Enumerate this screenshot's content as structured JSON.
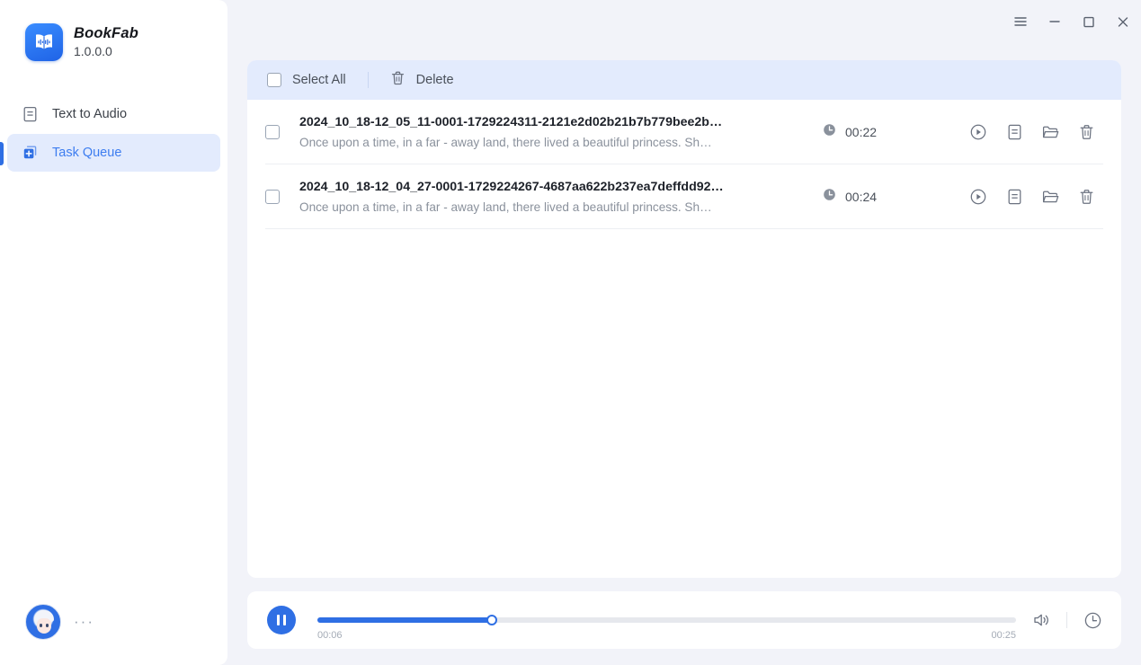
{
  "app": {
    "name": "BookFab",
    "version": "1.0.0.0",
    "logo_icon": "open-book-waveform-icon",
    "accent_color": "#2f6fe4",
    "toolbar_color": "#e3ebfd",
    "page_background": "#f2f3f9"
  },
  "titlebar": {
    "buttons": [
      {
        "name": "menu-button",
        "icon": "hamburger-menu-icon"
      },
      {
        "name": "minimize-button",
        "icon": "minimize-icon"
      },
      {
        "name": "maximize-button",
        "icon": "maximize-icon"
      },
      {
        "name": "close-button",
        "icon": "close-icon"
      }
    ]
  },
  "sidebar": {
    "items": [
      {
        "label": "Text to Audio",
        "icon": "document-text-icon",
        "active": false
      },
      {
        "label": "Task Queue",
        "icon": "task-queue-add-icon",
        "active": true
      }
    ],
    "user": {
      "avatar_icon": "user-avatar",
      "more": "···"
    }
  },
  "toolbar": {
    "select_all_label": "Select All",
    "delete_label": "Delete",
    "select_all_checked": false,
    "delete_icon": "trash-icon"
  },
  "tasks": [
    {
      "title": "2024_10_18-12_05_11-0001-1729224311-2121e2d02b21b7b779bee2b…",
      "subtitle": "Once upon a time, in a far - away land, there lived a beautiful princess. Sh…",
      "duration": "00:22",
      "checked": false,
      "duration_icon": "clock-icon",
      "actions": [
        {
          "name": "play-action",
          "icon": "play-circle-icon"
        },
        {
          "name": "view-text-action",
          "icon": "document-text-icon"
        },
        {
          "name": "open-folder-action",
          "icon": "folder-icon"
        },
        {
          "name": "delete-action",
          "icon": "trash-icon"
        }
      ]
    },
    {
      "title": "2024_10_18-12_04_27-0001-1729224267-4687aa622b237ea7deffdd92…",
      "subtitle": "Once upon a time, in a far - away land, there lived a beautiful princess. Sh…",
      "duration": "00:24",
      "checked": false,
      "duration_icon": "clock-icon",
      "actions": [
        {
          "name": "play-action",
          "icon": "play-circle-icon"
        },
        {
          "name": "view-text-action",
          "icon": "document-text-icon"
        },
        {
          "name": "open-folder-action",
          "icon": "folder-icon"
        },
        {
          "name": "delete-action",
          "icon": "trash-icon"
        }
      ]
    }
  ],
  "player": {
    "state": "playing",
    "toggle_icon": "pause-icon",
    "current_time": "00:06",
    "total_time": "00:25",
    "progress_percent": 25,
    "volume_icon": "volume-icon",
    "timer_icon": "clock-icon"
  }
}
